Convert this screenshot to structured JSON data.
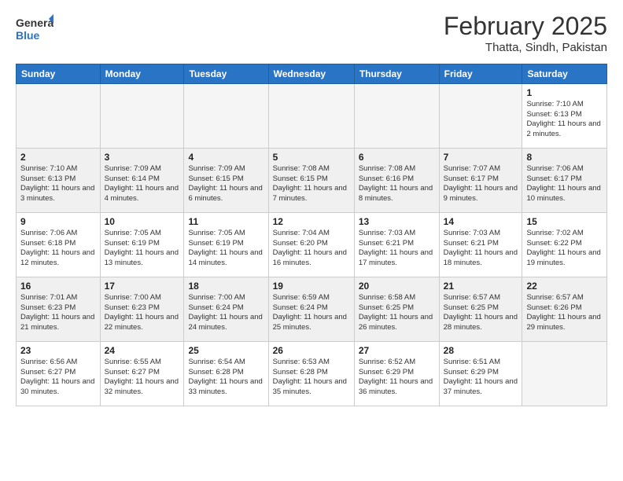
{
  "header": {
    "logo_general": "General",
    "logo_blue": "Blue",
    "month": "February 2025",
    "location": "Thatta, Sindh, Pakistan"
  },
  "weekdays": [
    "Sunday",
    "Monday",
    "Tuesday",
    "Wednesday",
    "Thursday",
    "Friday",
    "Saturday"
  ],
  "weeks": [
    [
      {
        "day": "",
        "info": ""
      },
      {
        "day": "",
        "info": ""
      },
      {
        "day": "",
        "info": ""
      },
      {
        "day": "",
        "info": ""
      },
      {
        "day": "",
        "info": ""
      },
      {
        "day": "",
        "info": ""
      },
      {
        "day": "1",
        "info": "Sunrise: 7:10 AM\nSunset: 6:13 PM\nDaylight: 11 hours\nand 2 minutes."
      }
    ],
    [
      {
        "day": "2",
        "info": "Sunrise: 7:10 AM\nSunset: 6:13 PM\nDaylight: 11 hours\nand 3 minutes."
      },
      {
        "day": "3",
        "info": "Sunrise: 7:09 AM\nSunset: 6:14 PM\nDaylight: 11 hours\nand 4 minutes."
      },
      {
        "day": "4",
        "info": "Sunrise: 7:09 AM\nSunset: 6:15 PM\nDaylight: 11 hours\nand 6 minutes."
      },
      {
        "day": "5",
        "info": "Sunrise: 7:08 AM\nSunset: 6:15 PM\nDaylight: 11 hours\nand 7 minutes."
      },
      {
        "day": "6",
        "info": "Sunrise: 7:08 AM\nSunset: 6:16 PM\nDaylight: 11 hours\nand 8 minutes."
      },
      {
        "day": "7",
        "info": "Sunrise: 7:07 AM\nSunset: 6:17 PM\nDaylight: 11 hours\nand 9 minutes."
      },
      {
        "day": "8",
        "info": "Sunrise: 7:06 AM\nSunset: 6:17 PM\nDaylight: 11 hours\nand 10 minutes."
      }
    ],
    [
      {
        "day": "9",
        "info": "Sunrise: 7:06 AM\nSunset: 6:18 PM\nDaylight: 11 hours\nand 12 minutes."
      },
      {
        "day": "10",
        "info": "Sunrise: 7:05 AM\nSunset: 6:19 PM\nDaylight: 11 hours\nand 13 minutes."
      },
      {
        "day": "11",
        "info": "Sunrise: 7:05 AM\nSunset: 6:19 PM\nDaylight: 11 hours\nand 14 minutes."
      },
      {
        "day": "12",
        "info": "Sunrise: 7:04 AM\nSunset: 6:20 PM\nDaylight: 11 hours\nand 16 minutes."
      },
      {
        "day": "13",
        "info": "Sunrise: 7:03 AM\nSunset: 6:21 PM\nDaylight: 11 hours\nand 17 minutes."
      },
      {
        "day": "14",
        "info": "Sunrise: 7:03 AM\nSunset: 6:21 PM\nDaylight: 11 hours\nand 18 minutes."
      },
      {
        "day": "15",
        "info": "Sunrise: 7:02 AM\nSunset: 6:22 PM\nDaylight: 11 hours\nand 19 minutes."
      }
    ],
    [
      {
        "day": "16",
        "info": "Sunrise: 7:01 AM\nSunset: 6:23 PM\nDaylight: 11 hours\nand 21 minutes."
      },
      {
        "day": "17",
        "info": "Sunrise: 7:00 AM\nSunset: 6:23 PM\nDaylight: 11 hours\nand 22 minutes."
      },
      {
        "day": "18",
        "info": "Sunrise: 7:00 AM\nSunset: 6:24 PM\nDaylight: 11 hours\nand 24 minutes."
      },
      {
        "day": "19",
        "info": "Sunrise: 6:59 AM\nSunset: 6:24 PM\nDaylight: 11 hours\nand 25 minutes."
      },
      {
        "day": "20",
        "info": "Sunrise: 6:58 AM\nSunset: 6:25 PM\nDaylight: 11 hours\nand 26 minutes."
      },
      {
        "day": "21",
        "info": "Sunrise: 6:57 AM\nSunset: 6:25 PM\nDaylight: 11 hours\nand 28 minutes."
      },
      {
        "day": "22",
        "info": "Sunrise: 6:57 AM\nSunset: 6:26 PM\nDaylight: 11 hours\nand 29 minutes."
      }
    ],
    [
      {
        "day": "23",
        "info": "Sunrise: 6:56 AM\nSunset: 6:27 PM\nDaylight: 11 hours\nand 30 minutes."
      },
      {
        "day": "24",
        "info": "Sunrise: 6:55 AM\nSunset: 6:27 PM\nDaylight: 11 hours\nand 32 minutes."
      },
      {
        "day": "25",
        "info": "Sunrise: 6:54 AM\nSunset: 6:28 PM\nDaylight: 11 hours\nand 33 minutes."
      },
      {
        "day": "26",
        "info": "Sunrise: 6:53 AM\nSunset: 6:28 PM\nDaylight: 11 hours\nand 35 minutes."
      },
      {
        "day": "27",
        "info": "Sunrise: 6:52 AM\nSunset: 6:29 PM\nDaylight: 11 hours\nand 36 minutes."
      },
      {
        "day": "28",
        "info": "Sunrise: 6:51 AM\nSunset: 6:29 PM\nDaylight: 11 hours\nand 37 minutes."
      },
      {
        "day": "",
        "info": ""
      }
    ]
  ]
}
